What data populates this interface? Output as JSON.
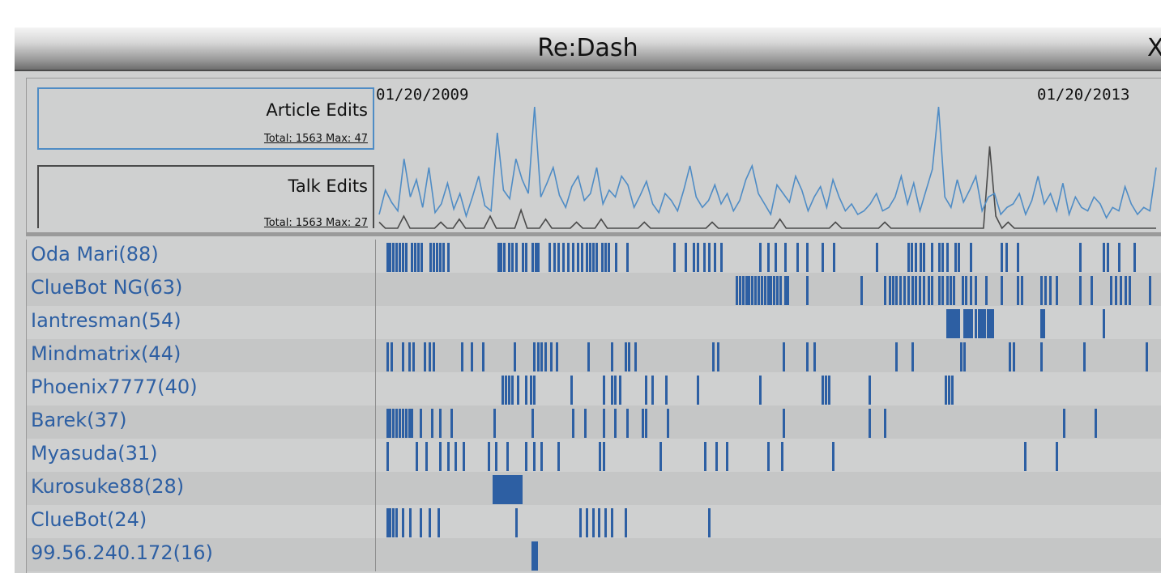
{
  "window": {
    "title": "Re:Dash",
    "close_glyph": "X"
  },
  "overview": {
    "date_start": "01/20/2009",
    "date_end": "01/20/2013",
    "legend": {
      "article": {
        "name": "Article Edits",
        "stats": "Total: 1563   Max: 47",
        "color": "#4f8cc5"
      },
      "talk": {
        "name": "Talk Edits",
        "stats": "Total: 1563   Max: 27",
        "color": "#4a4a4a"
      }
    },
    "article_series": [
      8,
      22,
      15,
      10,
      40,
      18,
      28,
      12,
      35,
      9,
      14,
      26,
      11,
      20,
      7,
      18,
      30,
      13,
      10,
      55,
      22,
      17,
      40,
      28,
      20,
      70,
      18,
      26,
      35,
      19,
      12,
      24,
      30,
      16,
      20,
      35,
      14,
      22,
      18,
      30,
      25,
      12,
      19,
      27,
      14,
      9,
      20,
      16,
      10,
      22,
      36,
      18,
      12,
      16,
      25,
      14,
      20,
      10,
      16,
      28,
      36,
      20,
      14,
      8,
      25,
      20,
      15,
      30,
      22,
      10,
      18,
      24,
      12,
      28,
      18,
      10,
      14,
      8,
      10,
      14,
      20,
      10,
      12,
      18,
      30,
      14,
      26,
      10,
      22,
      34,
      70,
      18,
      12,
      28,
      15,
      22,
      30,
      10,
      18,
      20,
      8,
      12,
      14,
      20,
      8,
      16,
      30,
      14,
      20,
      10,
      26,
      8,
      18,
      12,
      10,
      18,
      14,
      6,
      12,
      10,
      24,
      14,
      8,
      12,
      10,
      35
    ],
    "talk_series": [
      2,
      0,
      0,
      0,
      4,
      0,
      0,
      0,
      0,
      0,
      2,
      0,
      0,
      3,
      0,
      0,
      0,
      0,
      4,
      0,
      0,
      0,
      0,
      6,
      0,
      0,
      0,
      3,
      0,
      0,
      0,
      0,
      2,
      0,
      0,
      0,
      3,
      0,
      0,
      0,
      0,
      0,
      0,
      2,
      0,
      0,
      0,
      0,
      0,
      0,
      0,
      0,
      0,
      0,
      2,
      0,
      0,
      0,
      0,
      0,
      0,
      0,
      0,
      0,
      0,
      3,
      0,
      0,
      0,
      0,
      0,
      0,
      0,
      0,
      2,
      0,
      0,
      0,
      0,
      0,
      0,
      0,
      2,
      0,
      0,
      0,
      0,
      0,
      0,
      0,
      0,
      0,
      0,
      0,
      0,
      0,
      0,
      0,
      0,
      27,
      4,
      0,
      2,
      0,
      0,
      0,
      0,
      0,
      0,
      0,
      0,
      0,
      0,
      0,
      0,
      0,
      0,
      0,
      0,
      0,
      0,
      0,
      0,
      0,
      0,
      0,
      0
    ],
    "article_max": 47,
    "talk_max": 27
  },
  "users": [
    {
      "label": "Oda Mari(88)",
      "edits": [
        0.012,
        0.016,
        0.02,
        0.024,
        0.028,
        0.032,
        0.036,
        0.044,
        0.048,
        0.052,
        0.056,
        0.068,
        0.072,
        0.076,
        0.08,
        0.084,
        0.09,
        0.155,
        0.158,
        0.162,
        0.168,
        0.172,
        0.178,
        0.186,
        0.19,
        0.198,
        0.202,
        0.206,
        0.22,
        0.226,
        0.232,
        0.238,
        0.244,
        0.25,
        0.256,
        0.262,
        0.268,
        0.272,
        0.276,
        0.28,
        0.288,
        0.292,
        0.296,
        0.305,
        0.32,
        0.38,
        0.395,
        0.405,
        0.41,
        0.418,
        0.425,
        0.432,
        0.44,
        0.49,
        0.5,
        0.51,
        0.522,
        0.538,
        0.55,
        0.57,
        0.585,
        0.64,
        0.68,
        0.684,
        0.69,
        0.696,
        0.7,
        0.71,
        0.72,
        0.724,
        0.73,
        0.74,
        0.745,
        0.76,
        0.8,
        0.806,
        0.82,
        0.9,
        0.93,
        0.936,
        0.95,
        0.97
      ]
    },
    {
      "label": "ClueBot NG(63)",
      "edits": [
        0.46,
        0.464,
        0.468,
        0.472,
        0.476,
        0.48,
        0.484,
        0.488,
        0.492,
        0.496,
        0.5,
        0.504,
        0.508,
        0.512,
        0.516,
        0.522,
        0.525,
        0.55,
        0.62,
        0.65,
        0.656,
        0.66,
        0.665,
        0.67,
        0.675,
        0.68,
        0.685,
        0.69,
        0.695,
        0.7,
        0.706,
        0.71,
        0.72,
        0.724,
        0.73,
        0.734,
        0.738,
        0.75,
        0.754,
        0.76,
        0.766,
        0.78,
        0.8,
        0.82,
        0.826,
        0.85,
        0.856,
        0.862,
        0.87,
        0.9,
        0.915,
        0.94,
        0.946,
        0.952,
        0.958,
        0.964,
        0.99
      ]
    },
    {
      "label": "Iantresman(54)",
      "edits": [
        0.73,
        0.733,
        0.736,
        0.739,
        0.742,
        0.745,
        0.752,
        0.755,
        0.758,
        0.761,
        0.766,
        0.77,
        0.773,
        0.776,
        0.778,
        0.782,
        0.785,
        0.788,
        0.85,
        0.854,
        0.93
      ]
    },
    {
      "label": "Mindmatrix(44)",
      "edits": [
        0.012,
        0.018,
        0.032,
        0.04,
        0.046,
        0.06,
        0.066,
        0.072,
        0.108,
        0.12,
        0.135,
        0.175,
        0.2,
        0.206,
        0.21,
        0.215,
        0.222,
        0.23,
        0.27,
        0.3,
        0.318,
        0.322,
        0.33,
        0.43,
        0.436,
        0.52,
        0.55,
        0.56,
        0.665,
        0.685,
        0.748,
        0.752,
        0.81,
        0.815,
        0.85,
        0.905,
        0.985
      ]
    },
    {
      "label": "Phoenix7777(40)",
      "edits": [
        0.16,
        0.164,
        0.168,
        0.172,
        0.18,
        0.19,
        0.196,
        0.2,
        0.248,
        0.29,
        0.3,
        0.304,
        0.31,
        0.344,
        0.352,
        0.37,
        0.41,
        0.49,
        0.57,
        0.574,
        0.578,
        0.63,
        0.728,
        0.732,
        0.736
      ]
    },
    {
      "label": "Barek(37)",
      "edits": [
        0.012,
        0.016,
        0.02,
        0.024,
        0.028,
        0.032,
        0.036,
        0.04,
        0.044,
        0.055,
        0.07,
        0.08,
        0.095,
        0.15,
        0.198,
        0.25,
        0.266,
        0.29,
        0.304,
        0.32,
        0.34,
        0.344,
        0.372,
        0.52,
        0.63,
        0.65,
        0.88,
        0.92
      ]
    },
    {
      "label": "Myasuda(31)",
      "edits": [
        0.012,
        0.05,
        0.062,
        0.08,
        0.09,
        0.1,
        0.11,
        0.142,
        0.152,
        0.166,
        0.19,
        0.2,
        0.21,
        0.232,
        0.285,
        0.29,
        0.362,
        0.42,
        0.434,
        0.448,
        0.5,
        0.518,
        0.584,
        0.83,
        0.87
      ]
    },
    {
      "label": "Kurosuke88(28)",
      "edits": [
        0.148,
        0.151,
        0.154,
        0.157,
        0.16,
        0.163,
        0.166,
        0.169,
        0.172,
        0.175,
        0.178,
        0.181,
        0.184
      ]
    },
    {
      "label": "ClueBot(24)",
      "edits": [
        0.012,
        0.016,
        0.02,
        0.024,
        0.032,
        0.042,
        0.055,
        0.066,
        0.078,
        0.178,
        0.26,
        0.268,
        0.276,
        0.284,
        0.292,
        0.3,
        0.318,
        0.425
      ]
    },
    {
      "label": "99.56.240.172(16)",
      "edits": [
        0.198,
        0.2,
        0.202,
        0.204
      ]
    }
  ],
  "colors": {
    "edit_tick": "#2d5fa3",
    "user_label": "#2d5fa3",
    "article_line": "#4f8cc5",
    "talk_line": "#4a4a4a"
  }
}
